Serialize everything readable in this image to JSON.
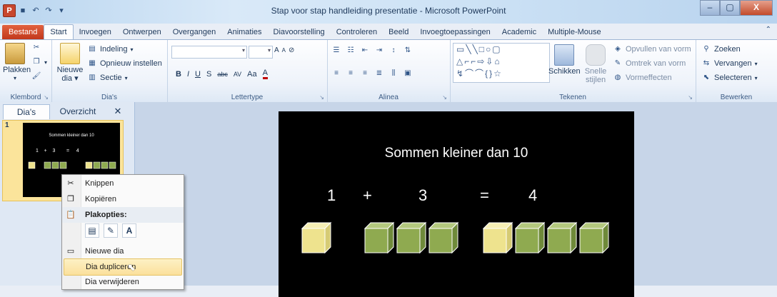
{
  "window": {
    "app_icon": "P",
    "title": "Stap voor stap handleiding presentatie - Microsoft PowerPoint",
    "qat_icons": [
      "save-icon",
      "undo-icon",
      "redo-icon",
      "customize-icon"
    ],
    "btn_min": "–",
    "btn_max": "▢",
    "btn_close": "X"
  },
  "tabs": [
    "Bestand",
    "Start",
    "Invoegen",
    "Ontwerpen",
    "Overgangen",
    "Animaties",
    "Diavoorstelling",
    "Controleren",
    "Beeld",
    "Invoegtoepassingen",
    "Academic",
    "Multiple-Mouse"
  ],
  "ribbon": {
    "clipboard": {
      "paste": "Plakken",
      "label": "Klembord"
    },
    "slides": {
      "new_slide_1": "Nieuwe",
      "new_slide_2": "dia",
      "layout": "Indeling",
      "reset": "Opnieuw instellen",
      "section": "Sectie",
      "label": "Dia's"
    },
    "font": {
      "label": "Lettertype",
      "bold": "B",
      "italic": "I",
      "underline": "U",
      "shadow": "S",
      "strike": "abc",
      "spacing": "AV",
      "case": "Aa",
      "color": "A",
      "grow": "A",
      "shrink": "A"
    },
    "paragraph": {
      "label": "Alinea"
    },
    "drawing": {
      "arrange": "Schikken",
      "quick_styles_1": "Snelle",
      "quick_styles_2": "stijlen",
      "fill": "Opvullen van vorm",
      "outline": "Omtrek van vorm",
      "effects": "Vormeffecten",
      "label": "Tekenen"
    },
    "editing": {
      "find": "Zoeken",
      "replace": "Vervangen",
      "select": "Selecteren",
      "label": "Bewerken"
    }
  },
  "left_pane": {
    "tab_slides": "Dia's",
    "tab_outline": "Overzicht",
    "close": "✕",
    "thumb_number": "1",
    "thumb_title": "Sommen kleiner dan 10",
    "thumb_eq": "1    +    3        =     4"
  },
  "slide": {
    "title": "Sommen kleiner dan 10",
    "eq_a": "1",
    "eq_plus": "+",
    "eq_b": "3",
    "eq_equals": "=",
    "eq_result": "4"
  },
  "context_menu": {
    "cut": "Knippen",
    "copy": "Kopiëren",
    "paste_header": "Plakopties:",
    "new_slide": "Nieuwe dia",
    "duplicate": "Dia dupliceren",
    "delete": "Dia verwijderen"
  },
  "colors": {
    "file_tab": "#c2381c",
    "cube_yellow": "#eee38e",
    "cube_green": "#8faa50",
    "highlight": "#fbe09b"
  }
}
